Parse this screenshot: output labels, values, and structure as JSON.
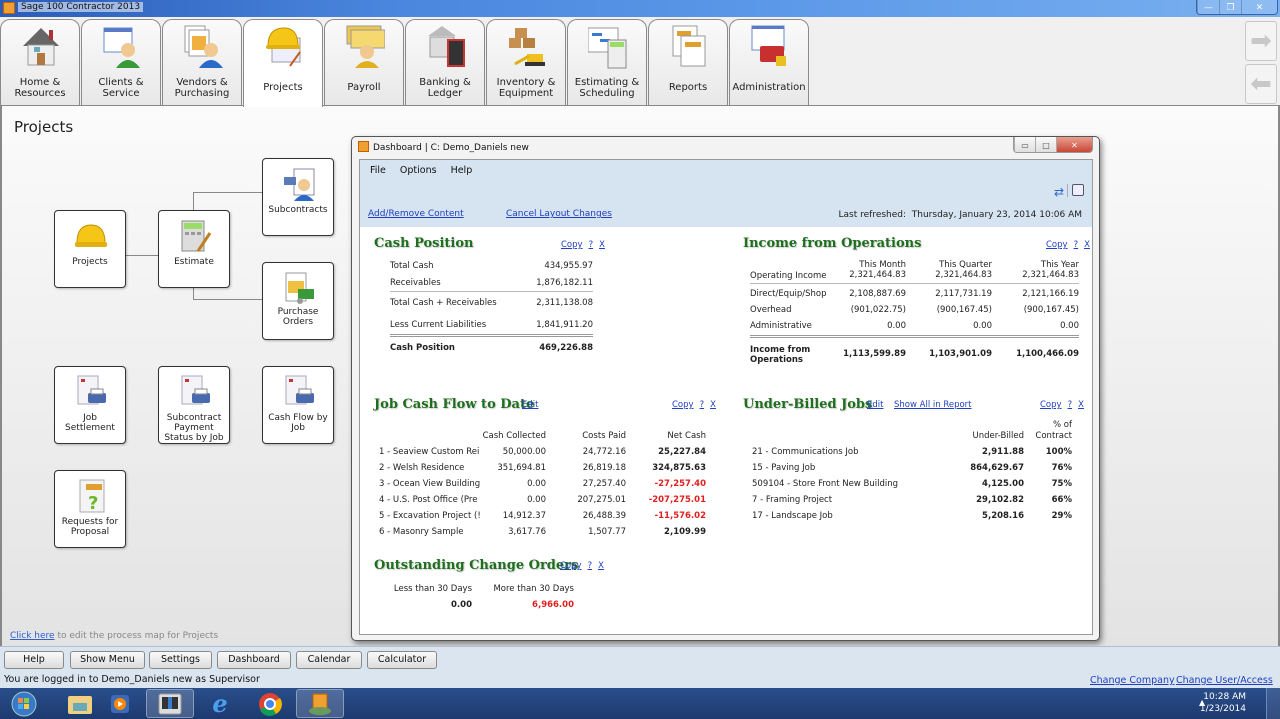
{
  "window": {
    "title": "Sage 100 Contractor 2013",
    "controls": {
      "minimize": "—",
      "restore": "❐",
      "close": "✕"
    }
  },
  "ribbon": {
    "tabs": [
      {
        "label_line1": "Home &",
        "label_line2": "Resources",
        "icon": "house-icon"
      },
      {
        "label_line1": "Clients &",
        "label_line2": "Service",
        "icon": "clients-icon"
      },
      {
        "label_line1": "Vendors &",
        "label_line2": "Purchasing",
        "icon": "vendors-icon"
      },
      {
        "label_line1": "Projects",
        "label_line2": "",
        "icon": "hardhat-icon",
        "active": true
      },
      {
        "label_line1": "Payroll",
        "label_line2": "",
        "icon": "payroll-icon"
      },
      {
        "label_line1": "Banking &",
        "label_line2": "Ledger",
        "icon": "bank-icon"
      },
      {
        "label_line1": "Inventory &",
        "label_line2": "Equipment",
        "icon": "excavator-icon"
      },
      {
        "label_line1": "Estimating &",
        "label_line2": "Scheduling",
        "icon": "calculator-icon"
      },
      {
        "label_line1": "Reports",
        "label_line2": "",
        "icon": "reports-icon"
      },
      {
        "label_line1": "Administration",
        "label_line2": "",
        "icon": "toolbox-icon"
      }
    ],
    "nav": {
      "forward": "➡",
      "back": "⬅"
    }
  },
  "page": {
    "title": "Projects",
    "process_map": {
      "nodes": [
        {
          "id": "projects",
          "label": "Projects"
        },
        {
          "id": "estimate",
          "label": "Estimate"
        },
        {
          "id": "subcontracts",
          "label": "Subcontracts"
        },
        {
          "id": "purchase-orders",
          "label": "Purchase Orders"
        },
        {
          "id": "job-settlement",
          "label": "Job Settlement"
        },
        {
          "id": "subcontract-payment",
          "label": "Subcontract Payment Status by Job"
        },
        {
          "id": "cash-flow-by-job",
          "label": "Cash Flow by Job"
        },
        {
          "id": "requests-for-proposal",
          "label": "Requests for Proposal"
        }
      ]
    },
    "edit_map_link": "Click here",
    "edit_map_text": " to edit the process map for Projects"
  },
  "dashboard": {
    "title": "Dashboard",
    "company": "C: Demo_Daniels new",
    "title_sep": "|",
    "menu": [
      "File",
      "Options",
      "Help"
    ],
    "add_remove": "Add/Remove Content",
    "cancel_layout": "Cancel Layout Changes",
    "last_refreshed_label": "Last refreshed:",
    "last_refreshed": "Thursday, January 23, 2014  10:06 AM",
    "copy": "Copy",
    "help": "?",
    "close": "X",
    "edit": "Edit",
    "cash_position": {
      "title": "Cash Position",
      "rows": [
        {
          "label": "Total Cash",
          "value": "434,955.97"
        },
        {
          "label": "Receivables",
          "value": "1,876,182.11"
        },
        {
          "label": "Total Cash + Receivables",
          "value": "2,311,138.08"
        },
        {
          "label": "Less Current Liabilities",
          "value": "1,841,911.20"
        },
        {
          "label": "Cash Position",
          "value": "469,226.88"
        }
      ]
    },
    "income": {
      "title": "Income from Operations",
      "columns": [
        "This Month",
        "This Quarter",
        "This Year"
      ],
      "rows": [
        {
          "label": "Operating Income",
          "values": [
            "2,321,464.83",
            "2,321,464.83",
            "2,321,464.83"
          ]
        },
        {
          "label": "Direct/Equip/Shop",
          "values": [
            "2,108,887.69",
            "2,117,731.19",
            "2,121,166.19"
          ]
        },
        {
          "label": "Overhead",
          "values": [
            "(901,022.75)",
            "(900,167.45)",
            "(900,167.45)"
          ]
        },
        {
          "label": "Administrative",
          "values": [
            "0.00",
            "0.00",
            "0.00"
          ]
        }
      ],
      "total": {
        "label_line1": "Income from",
        "label_line2": "Operations",
        "values": [
          "1,113,599.89",
          "1,103,901.09",
          "1,100,466.09"
        ]
      }
    },
    "job_cash_flow": {
      "title": "Job Cash Flow to Date",
      "columns": [
        "Cash Collected",
        "Costs Paid",
        "Net Cash"
      ],
      "rows": [
        {
          "job": "1 - Seaview Custom Rei",
          "collected": "50,000.00",
          "paid": "24,772.16",
          "net": "25,227.84",
          "negative": false
        },
        {
          "job": "2 - Welsh Residence",
          "collected": "351,694.81",
          "paid": "26,819.18",
          "net": "324,875.63",
          "negative": false
        },
        {
          "job": "3 - Ocean View Building",
          "collected": "0.00",
          "paid": "27,257.40",
          "net": "-27,257.40",
          "negative": true
        },
        {
          "job": "4 - U.S. Post Office (Pre",
          "collected": "0.00",
          "paid": "207,275.01",
          "net": "-207,275.01",
          "negative": true
        },
        {
          "job": "5 - Excavation Project (!",
          "collected": "14,912.37",
          "paid": "26,488.39",
          "net": "-11,576.02",
          "negative": true
        },
        {
          "job": "6 - Masonry Sample",
          "collected": "3,617.76",
          "paid": "1,507.77",
          "net": "2,109.99",
          "negative": false
        }
      ]
    },
    "under_billed": {
      "title": "Under-Billed Jobs",
      "show_all": "Show All in Report",
      "col_under": "Under-Billed",
      "col_pct_line1": "% of",
      "col_pct_line2": "Contract",
      "rows": [
        {
          "job": "21 - Communications Job",
          "amount": "2,911.88",
          "pct": "100%"
        },
        {
          "job": "15 - Paving Job",
          "amount": "864,629.67",
          "pct": "76%"
        },
        {
          "job": "509104 - Store Front New Building",
          "amount": "4,125.00",
          "pct": "75%"
        },
        {
          "job": "7 - Framing Project",
          "amount": "29,102.82",
          "pct": "66%"
        },
        {
          "job": "17 - Landscape Job",
          "amount": "5,208.16",
          "pct": "29%"
        }
      ]
    },
    "change_orders": {
      "title": "Outstanding Change Orders",
      "col_less": "Less than 30 Days",
      "col_more": "More than 30 Days",
      "less_value": "0.00",
      "more_value": "6,966.00"
    }
  },
  "bottom": {
    "buttons": [
      "Help",
      "Show Menu",
      "Settings",
      "Dashboard",
      "Calendar",
      "Calculator"
    ],
    "status": "You are logged in to Demo_Daniels new as Supervisor",
    "change_company": "Change Company",
    "change_user": "Change User/Access"
  },
  "taskbar": {
    "items": [
      "start-button",
      "explorer-icon",
      "media-player-icon",
      "app-window-icon",
      "internet-explorer-icon",
      "chrome-icon",
      "sage-icon"
    ],
    "time": "10:28 AM",
    "date": "1/23/2014",
    "tray_arrow": "▲"
  },
  "colors": {
    "section_title": "#1e6e1e",
    "negative": "#e02020",
    "link": "#2040c0",
    "dashboard_bar": "#d6e3f0"
  }
}
